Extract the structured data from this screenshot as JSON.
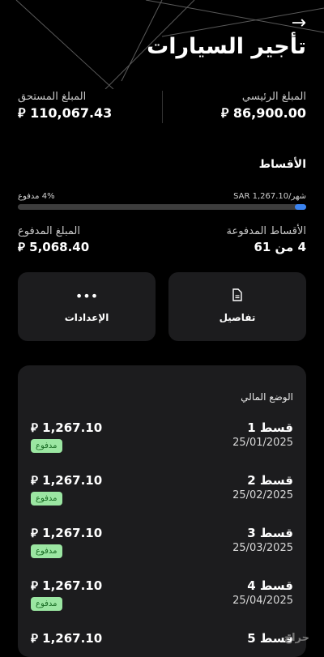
{
  "header": {
    "back_icon": "arrow-right-icon",
    "title": "تأجير السيارات"
  },
  "summary": {
    "principal_label": "المبلغ الرئيسي",
    "principal_value": "86,900.00",
    "due_label": "المبلغ المستحق",
    "due_value": "110,067.43",
    "currency_symbol": "⃁"
  },
  "installments_section": {
    "title": "الأقساط",
    "monthly_text": "شهر/SAR 1,267.10",
    "paid_percent_text": "4% مدفوع",
    "paid_fraction": 0.04,
    "paid_count_label": "الأقساط المدفوعة",
    "paid_count_value": "4 من 61",
    "paid_amount_label": "المبلغ المدفوع",
    "paid_amount_value": "5,068.40"
  },
  "actions": {
    "details_label": "تفاصيل",
    "details_icon": "document-icon",
    "settings_label": "الإعدادات",
    "settings_icon": "more-dots-icon"
  },
  "financial_status": {
    "title": "الوضع المالي",
    "rows": [
      {
        "name": "قسط 1",
        "date": "25/01/2025",
        "amount": "1,267.10",
        "status": "مدفوع"
      },
      {
        "name": "قسط 2",
        "date": "25/02/2025",
        "amount": "1,267.10",
        "status": "مدفوع"
      },
      {
        "name": "قسط 3",
        "date": "25/03/2025",
        "amount": "1,267.10",
        "status": "مدفوع"
      },
      {
        "name": "قسط 4",
        "date": "25/04/2025",
        "amount": "1,267.10",
        "status": "مدفوع"
      },
      {
        "name": "قسط 5",
        "date": "",
        "amount": "1,267.10",
        "status": ""
      }
    ]
  },
  "colors": {
    "background": "#000000",
    "card": "#1c1c1e",
    "accent_blue": "#3a83f0",
    "paid_badge_bg": "#9be6a2",
    "paid_badge_text": "#186b23"
  },
  "watermark": "حراج"
}
